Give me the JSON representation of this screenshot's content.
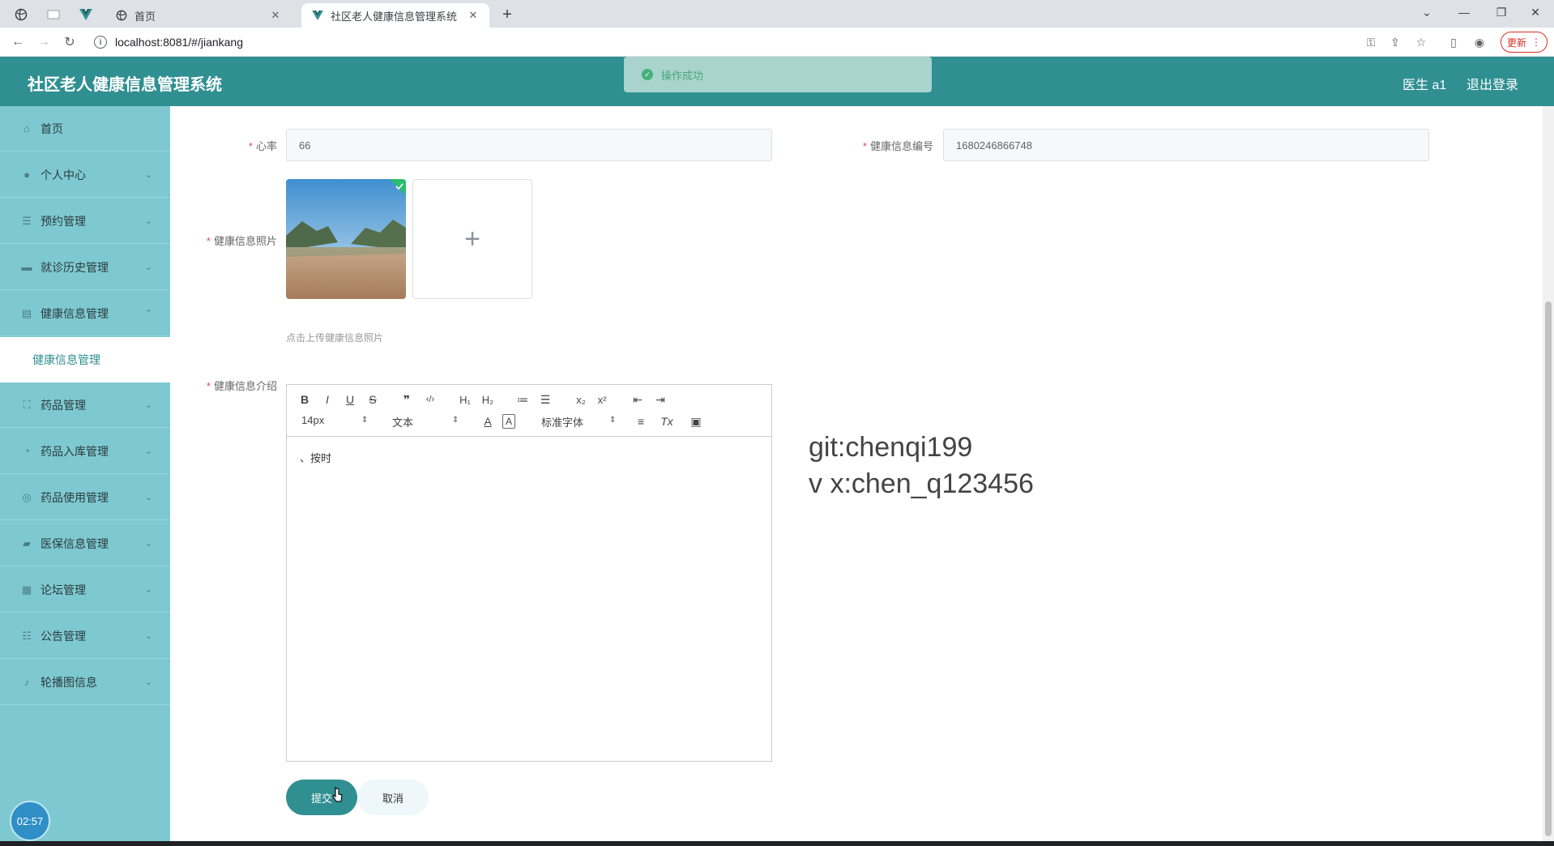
{
  "browser": {
    "tabs": [
      {
        "title": "首页",
        "active": false
      },
      {
        "title": "社区老人健康信息管理系统",
        "active": true
      }
    ],
    "url": "localhost:8081/#/jiankang",
    "update_label": "更新",
    "new_tab": "+",
    "close_glyph": "✕"
  },
  "header": {
    "title": "社区老人健康信息管理系统",
    "user": "医生 a1",
    "logout": "退出登录"
  },
  "toast": {
    "text": "操作成功"
  },
  "sidebar": {
    "items": [
      {
        "label": "首页",
        "icon": "home-icon",
        "glyph": "⌂"
      },
      {
        "label": "个人中心",
        "icon": "user-icon",
        "glyph": "●"
      },
      {
        "label": "预约管理",
        "icon": "list-icon",
        "glyph": "☰"
      },
      {
        "label": "就诊历史管理",
        "icon": "monitor-icon",
        "glyph": "▬"
      },
      {
        "label": "健康信息管理",
        "icon": "document-icon",
        "glyph": "▤"
      },
      {
        "label": "药品管理",
        "icon": "fullscreen-icon",
        "glyph": "⛶"
      },
      {
        "label": "药品入库管理",
        "icon": "circle-icon",
        "glyph": "◔"
      },
      {
        "label": "药品使用管理",
        "icon": "target-icon",
        "glyph": "◎"
      },
      {
        "label": "医保信息管理",
        "icon": "chat-icon",
        "glyph": "▰"
      },
      {
        "label": "论坛管理",
        "icon": "grid-icon",
        "glyph": "▦"
      },
      {
        "label": "公告管理",
        "icon": "sliders-icon",
        "glyph": "☷"
      },
      {
        "label": "轮播图信息",
        "icon": "microphone-icon",
        "glyph": "♪"
      }
    ],
    "sub_item": "健康信息管理",
    "timer": "02:57"
  },
  "form": {
    "heart_rate": {
      "label": "心率",
      "value": "66"
    },
    "health_id": {
      "label": "健康信息编号",
      "value": "1680246866748"
    },
    "photo": {
      "label": "健康信息照片",
      "tip": "点击上传健康信息照片",
      "plus": "+"
    },
    "intro": {
      "label": "健康信息介绍",
      "content": "、按时"
    },
    "editor": {
      "font_size": "14px",
      "header_select": "文本",
      "font_family": "标准字体"
    },
    "submit": "提交",
    "cancel": "取消"
  },
  "watermark": {
    "line1": "git:chenqi199",
    "line2": "v x:chen_q123456"
  }
}
